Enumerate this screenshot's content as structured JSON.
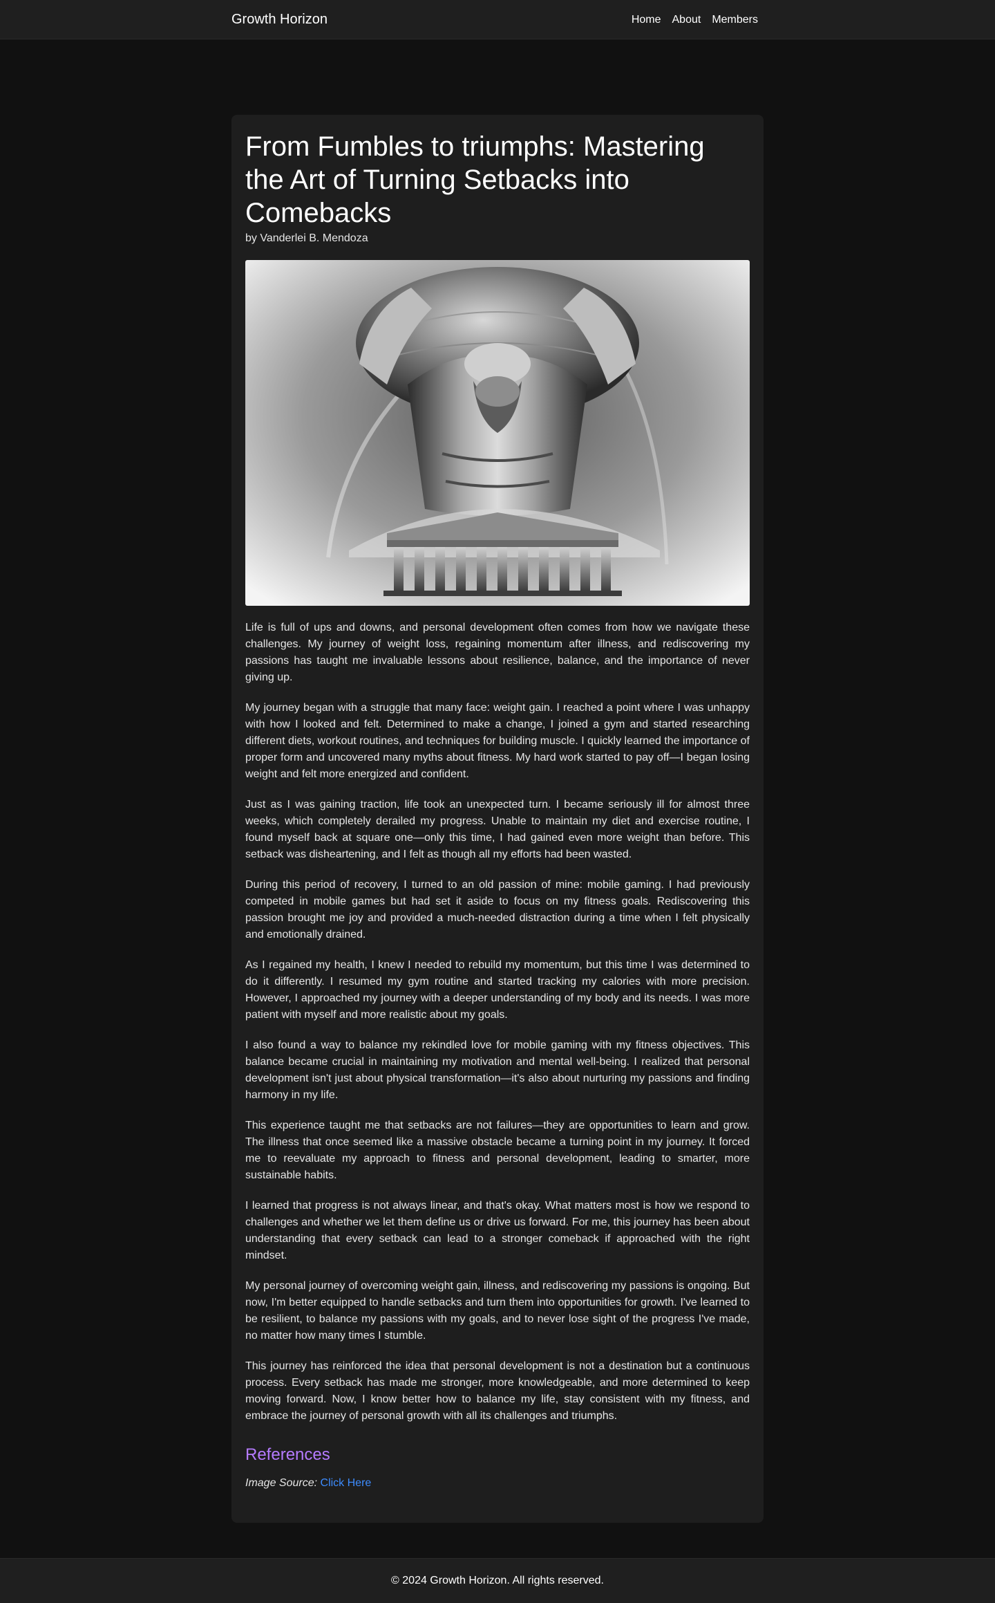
{
  "nav": {
    "brand": "Growth Horizon",
    "links": [
      "Home",
      "About",
      "Members"
    ]
  },
  "article": {
    "title": "From Fumbles to triumphs: Mastering the Art of Turning Setbacks into Comebacks",
    "author": "by Vanderlei B. Mendoza",
    "paragraphs": [
      "Life is full of ups and downs, and personal development often comes from how we navigate these challenges. My journey of weight loss, regaining momentum after illness, and rediscovering my passions has taught me invaluable lessons about resilience, balance, and the importance of never giving up.",
      "My journey began with a struggle that many face: weight gain. I reached a point where I was unhappy with how I looked and felt. Determined to make a change, I joined a gym and started researching different diets, workout routines, and techniques for building muscle. I quickly learned the importance of proper form and uncovered many myths about fitness. My hard work started to pay off—I began losing weight and felt more energized and confident.",
      "Just as I was gaining traction, life took an unexpected turn. I became seriously ill for almost three weeks, which completely derailed my progress. Unable to maintain my diet and exercise routine, I found myself back at square one—only this time, I had gained even more weight than before. This setback was disheartening, and I felt as though all my efforts had been wasted.",
      "During this period of recovery, I turned to an old passion of mine: mobile gaming. I had previously competed in mobile games but had set it aside to focus on my fitness goals. Rediscovering this passion brought me joy and provided a much-needed distraction during a time when I felt physically and emotionally drained.",
      "As I regained my health, I knew I needed to rebuild my momentum, but this time I was determined to do it differently. I resumed my gym routine and started tracking my calories with more precision. However, I approached my journey with a deeper understanding of my body and its needs. I was more patient with myself and more realistic about my goals.",
      "I also found a way to balance my rekindled love for mobile gaming with my fitness objectives. This balance became crucial in maintaining my motivation and mental well-being. I realized that personal development isn't just about physical transformation—it's also about nurturing my passions and finding harmony in my life.",
      "This experience taught me that setbacks are not failures—they are opportunities to learn and grow. The illness that once seemed like a massive obstacle became a turning point in my journey. It forced me to reevaluate my approach to fitness and personal development, leading to smarter, more sustainable habits.",
      "I learned that progress is not always linear, and that's okay. What matters most is how we respond to challenges and whether we let them define us or drive us forward. For me, this journey has been about understanding that every setback can lead to a stronger comeback if approached with the right mindset.",
      "My personal journey of overcoming weight gain, illness, and rediscovering my passions is ongoing. But now, I'm better equipped to handle setbacks and turn them into opportunities for growth. I've learned to be resilient, to balance my passions with my goals, and to never lose sight of the progress I've made, no matter how many times I stumble.",
      "This journey has reinforced the idea that personal development is not a destination but a continuous process. Every setback has made me stronger, more knowledgeable, and more determined to keep moving forward. Now, I know better how to balance my life, stay consistent with my fitness, and embrace the journey of personal growth with all its challenges and triumphs."
    ]
  },
  "references": {
    "heading": "References",
    "source_label": "Image Source:",
    "link_text": "Click Here"
  },
  "footer": {
    "text": "© 2024 Growth Horizon. All rights reserved."
  },
  "colors": {
    "page_bg": "#111111",
    "card_bg": "#1e1e1e",
    "nav_bg": "#1f1f1f",
    "references_heading": "#b57bff",
    "link": "#3d8cff"
  }
}
